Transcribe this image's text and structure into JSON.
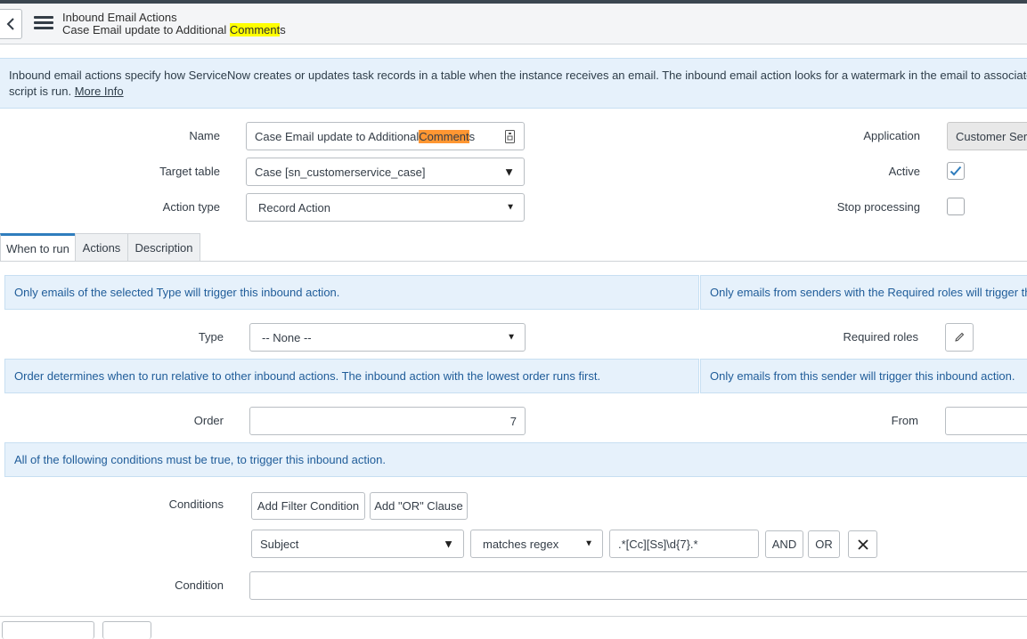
{
  "header": {
    "title": "Inbound Email Actions",
    "subtitle_prefix": "Case Email update to Additional ",
    "subtitle_highlight": "Comment",
    "subtitle_suffix": "s"
  },
  "banner": {
    "text": "Inbound email actions specify how ServiceNow creates or updates task records in a table when the instance receives an email. The inbound email action looks for a watermark in the email to associate it with a spec",
    "text_line2": "script is run.",
    "more_info": "More Info"
  },
  "form": {
    "name_label": "Name",
    "name_prefix": "Case Email update to Additional ",
    "name_highlight": "Comment",
    "name_suffix": "s",
    "target_table_label": "Target table",
    "target_table_value": "Case [sn_customerservice_case]",
    "action_type_label": "Action type",
    "action_type_value": "Record Action",
    "application_label": "Application",
    "application_value": "Customer Serv",
    "active_label": "Active",
    "active_checked": true,
    "stop_processing_label": "Stop processing",
    "stop_processing_checked": false
  },
  "tabs": [
    {
      "label": "When to run",
      "active": true
    },
    {
      "label": "Actions",
      "active": false
    },
    {
      "label": "Description",
      "active": false
    }
  ],
  "when_to_run": {
    "type_hint": "Only emails of the selected Type will trigger this inbound action.",
    "roles_hint": "Only emails from senders with the Required roles will trigger this in",
    "type_label": "Type",
    "type_value": "-- None --",
    "required_roles_label": "Required roles",
    "order_hint": "Order determines when to run relative to other inbound actions. The inbound action with the lowest order runs first.",
    "from_hint": "Only emails from this sender will trigger this inbound action.",
    "order_label": "Order",
    "order_value": "7",
    "from_label": "From",
    "from_value": "",
    "conditions_hint": "All of the following conditions must be true, to trigger this inbound action.",
    "conditions_label": "Conditions",
    "add_filter_label": "Add Filter Condition",
    "add_or_label": "Add \"OR\" Clause",
    "cond_field": "Subject",
    "cond_operator": "matches regex",
    "cond_value": ".*[Cc][Ss]\\d{7}.*",
    "and_label": "AND",
    "or_label": "OR",
    "condition_label": "Condition",
    "condition_value": ""
  },
  "colors": {
    "accent": "#2f7dbd",
    "hint_bg": "#e6f1fb",
    "hint_text": "#1f5c99",
    "highlight_yellow": "#ffff00",
    "highlight_orange": "#ff9632"
  }
}
